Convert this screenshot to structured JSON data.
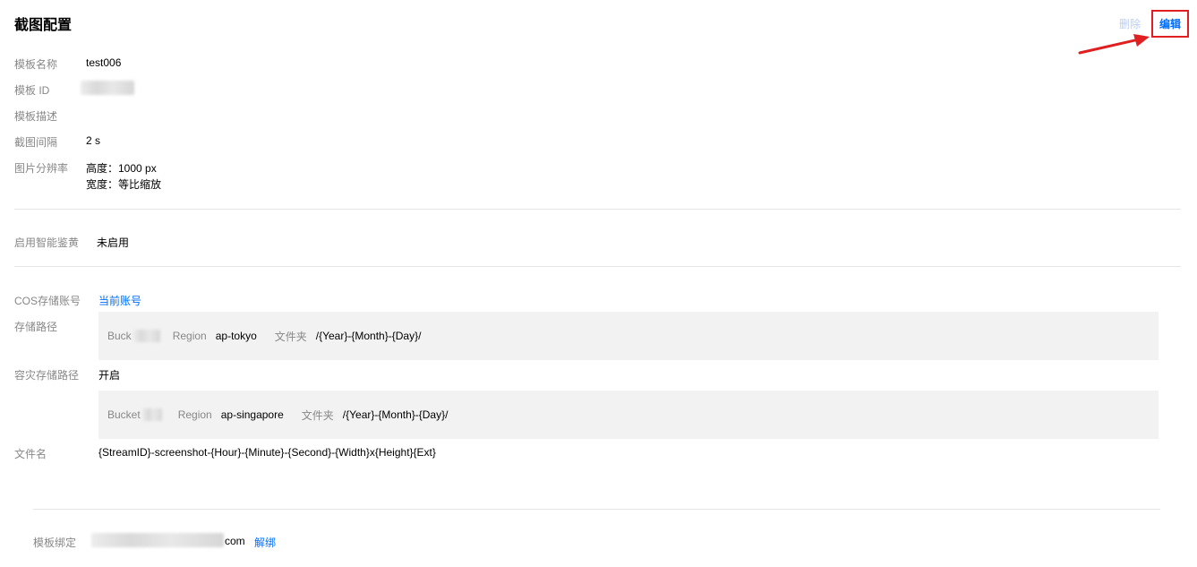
{
  "header": {
    "title": "截图配置",
    "delete_label": "删除",
    "edit_label": "编辑"
  },
  "basic": {
    "template_name_label": "模板名称",
    "template_name_value": "test006",
    "template_id_label": "模板 ID",
    "template_desc_label": "模板描述",
    "interval_label": "截图间隔",
    "interval_value": "2 s",
    "resolution_label": "图片分辨率",
    "resolution_height": "高度：1000 px",
    "resolution_width": "宽度：等比缩放"
  },
  "porn": {
    "label": "启用智能鉴黄",
    "value": "未启用"
  },
  "storage": {
    "cos_label": "COS存储账号",
    "cos_value": "当前账号",
    "path_label": "存储路径",
    "path": {
      "bucket_label": "Buck",
      "region_label": "Region",
      "region_value": "ap-tokyo",
      "folder_label": "文件夹",
      "folder_value": "/{Year}-{Month}-{Day}/"
    },
    "dr_label": "容灾存储路径",
    "dr_value": "开启",
    "dr_path": {
      "bucket_label": "Bucket",
      "region_label": "Region",
      "region_value": "ap-singapore",
      "folder_label": "文件夹",
      "folder_value": "/{Year}-{Month}-{Day}/"
    },
    "filename_label": "文件名",
    "filename_value": "{StreamID}-screenshot-{Hour}-{Minute}-{Second}-{Width}x{Height}{Ext}"
  },
  "binding": {
    "label": "模板绑定",
    "domain_suffix": "com",
    "unbind_label": "解绑"
  },
  "colors": {
    "accent": "#006eff",
    "highlight": "#e02020",
    "label_gray": "#888888",
    "box_bg": "#f2f2f2"
  }
}
